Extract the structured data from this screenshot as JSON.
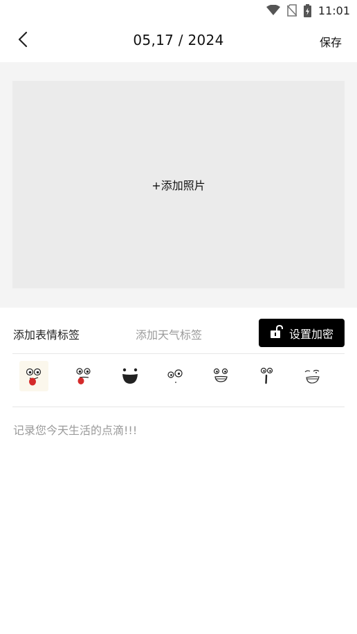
{
  "status_bar": {
    "time": "11:01",
    "icons": [
      "wifi-icon",
      "no-sim-icon",
      "battery-charging-icon"
    ]
  },
  "header": {
    "back_icon": "chevron-left-icon",
    "title": "05,17 / 2024",
    "save_label": "保存"
  },
  "photo": {
    "add_label": "+添加照片"
  },
  "tags": {
    "mood_label": "添加表情标签",
    "weather_label": "添加天气标签",
    "encrypt_label": "设置加密",
    "encrypt_icon": "unlock-icon"
  },
  "emojis": {
    "items": [
      "tongue-out-face-icon",
      "wink-tongue-face-icon",
      "grin-face-icon",
      "confused-face-icon",
      "teeth-grimace-face-icon",
      "surprised-face-icon",
      "smirk-face-icon"
    ],
    "selected_index": 0
  },
  "note": {
    "placeholder": "记录您今天生活的点滴!!!"
  },
  "colors": {
    "photo_section_bg": "#f4f4f4",
    "photo_box_bg": "#ebebeb",
    "button_bg": "#000000",
    "muted_text": "#9a9a9a"
  }
}
